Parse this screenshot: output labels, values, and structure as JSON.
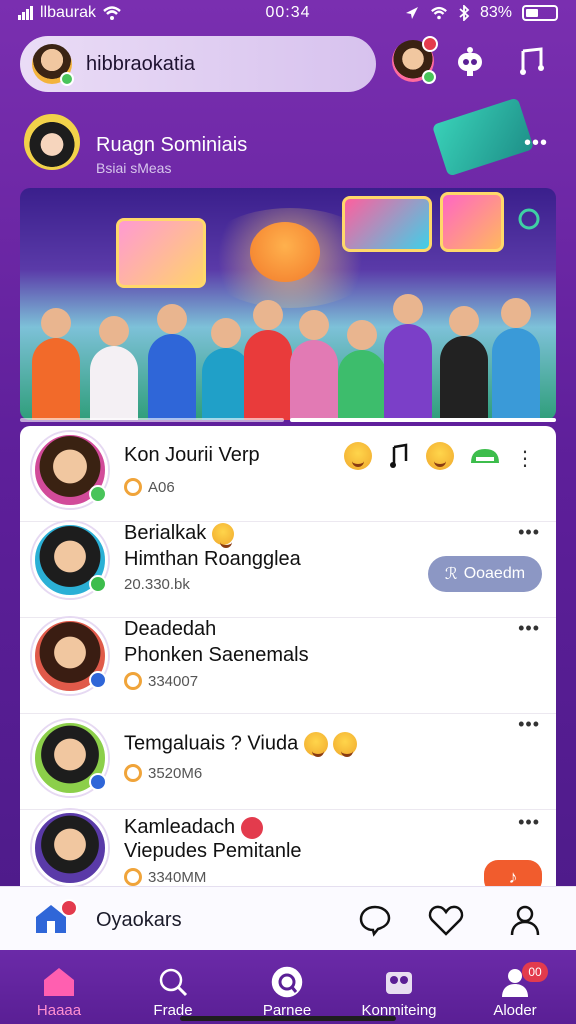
{
  "status_bar": {
    "carrier": "llbaurak",
    "time": "00:34",
    "battery": "83%"
  },
  "header": {
    "search_text": "hibbraokatia"
  },
  "profile": {
    "name": "Ruagn Sominiais",
    "subtitle": "Bsiai sMeas"
  },
  "feed": {
    "items": [
      {
        "title": "Kon Jourii Verp",
        "meta": "A06"
      },
      {
        "title_line1": "Berialkak",
        "title_line2": "Himthan Roangglea",
        "meta": "20.330.bk",
        "action_label": "Ooaedm"
      },
      {
        "title_line1": "Deadedah",
        "title_line2": "Phonken Saenemals",
        "meta": "334007"
      },
      {
        "title": "Temgaluais ? Viuda",
        "meta": "3520M6"
      },
      {
        "title_line1": "Kamleadach",
        "title_line2": "Viepudes Pemitanle",
        "meta": "3340MM"
      }
    ]
  },
  "compose": {
    "label": "Oyaokars"
  },
  "nav": {
    "items": [
      {
        "label": "Haaaa"
      },
      {
        "label": "Frade"
      },
      {
        "label": "Parnee"
      },
      {
        "label": "Konmiteing"
      },
      {
        "label": "Aloder",
        "badge": "00"
      }
    ]
  },
  "colors": {
    "accent": "#7a2fb0",
    "badge": "#e33b4d",
    "online": "#49c45a"
  }
}
